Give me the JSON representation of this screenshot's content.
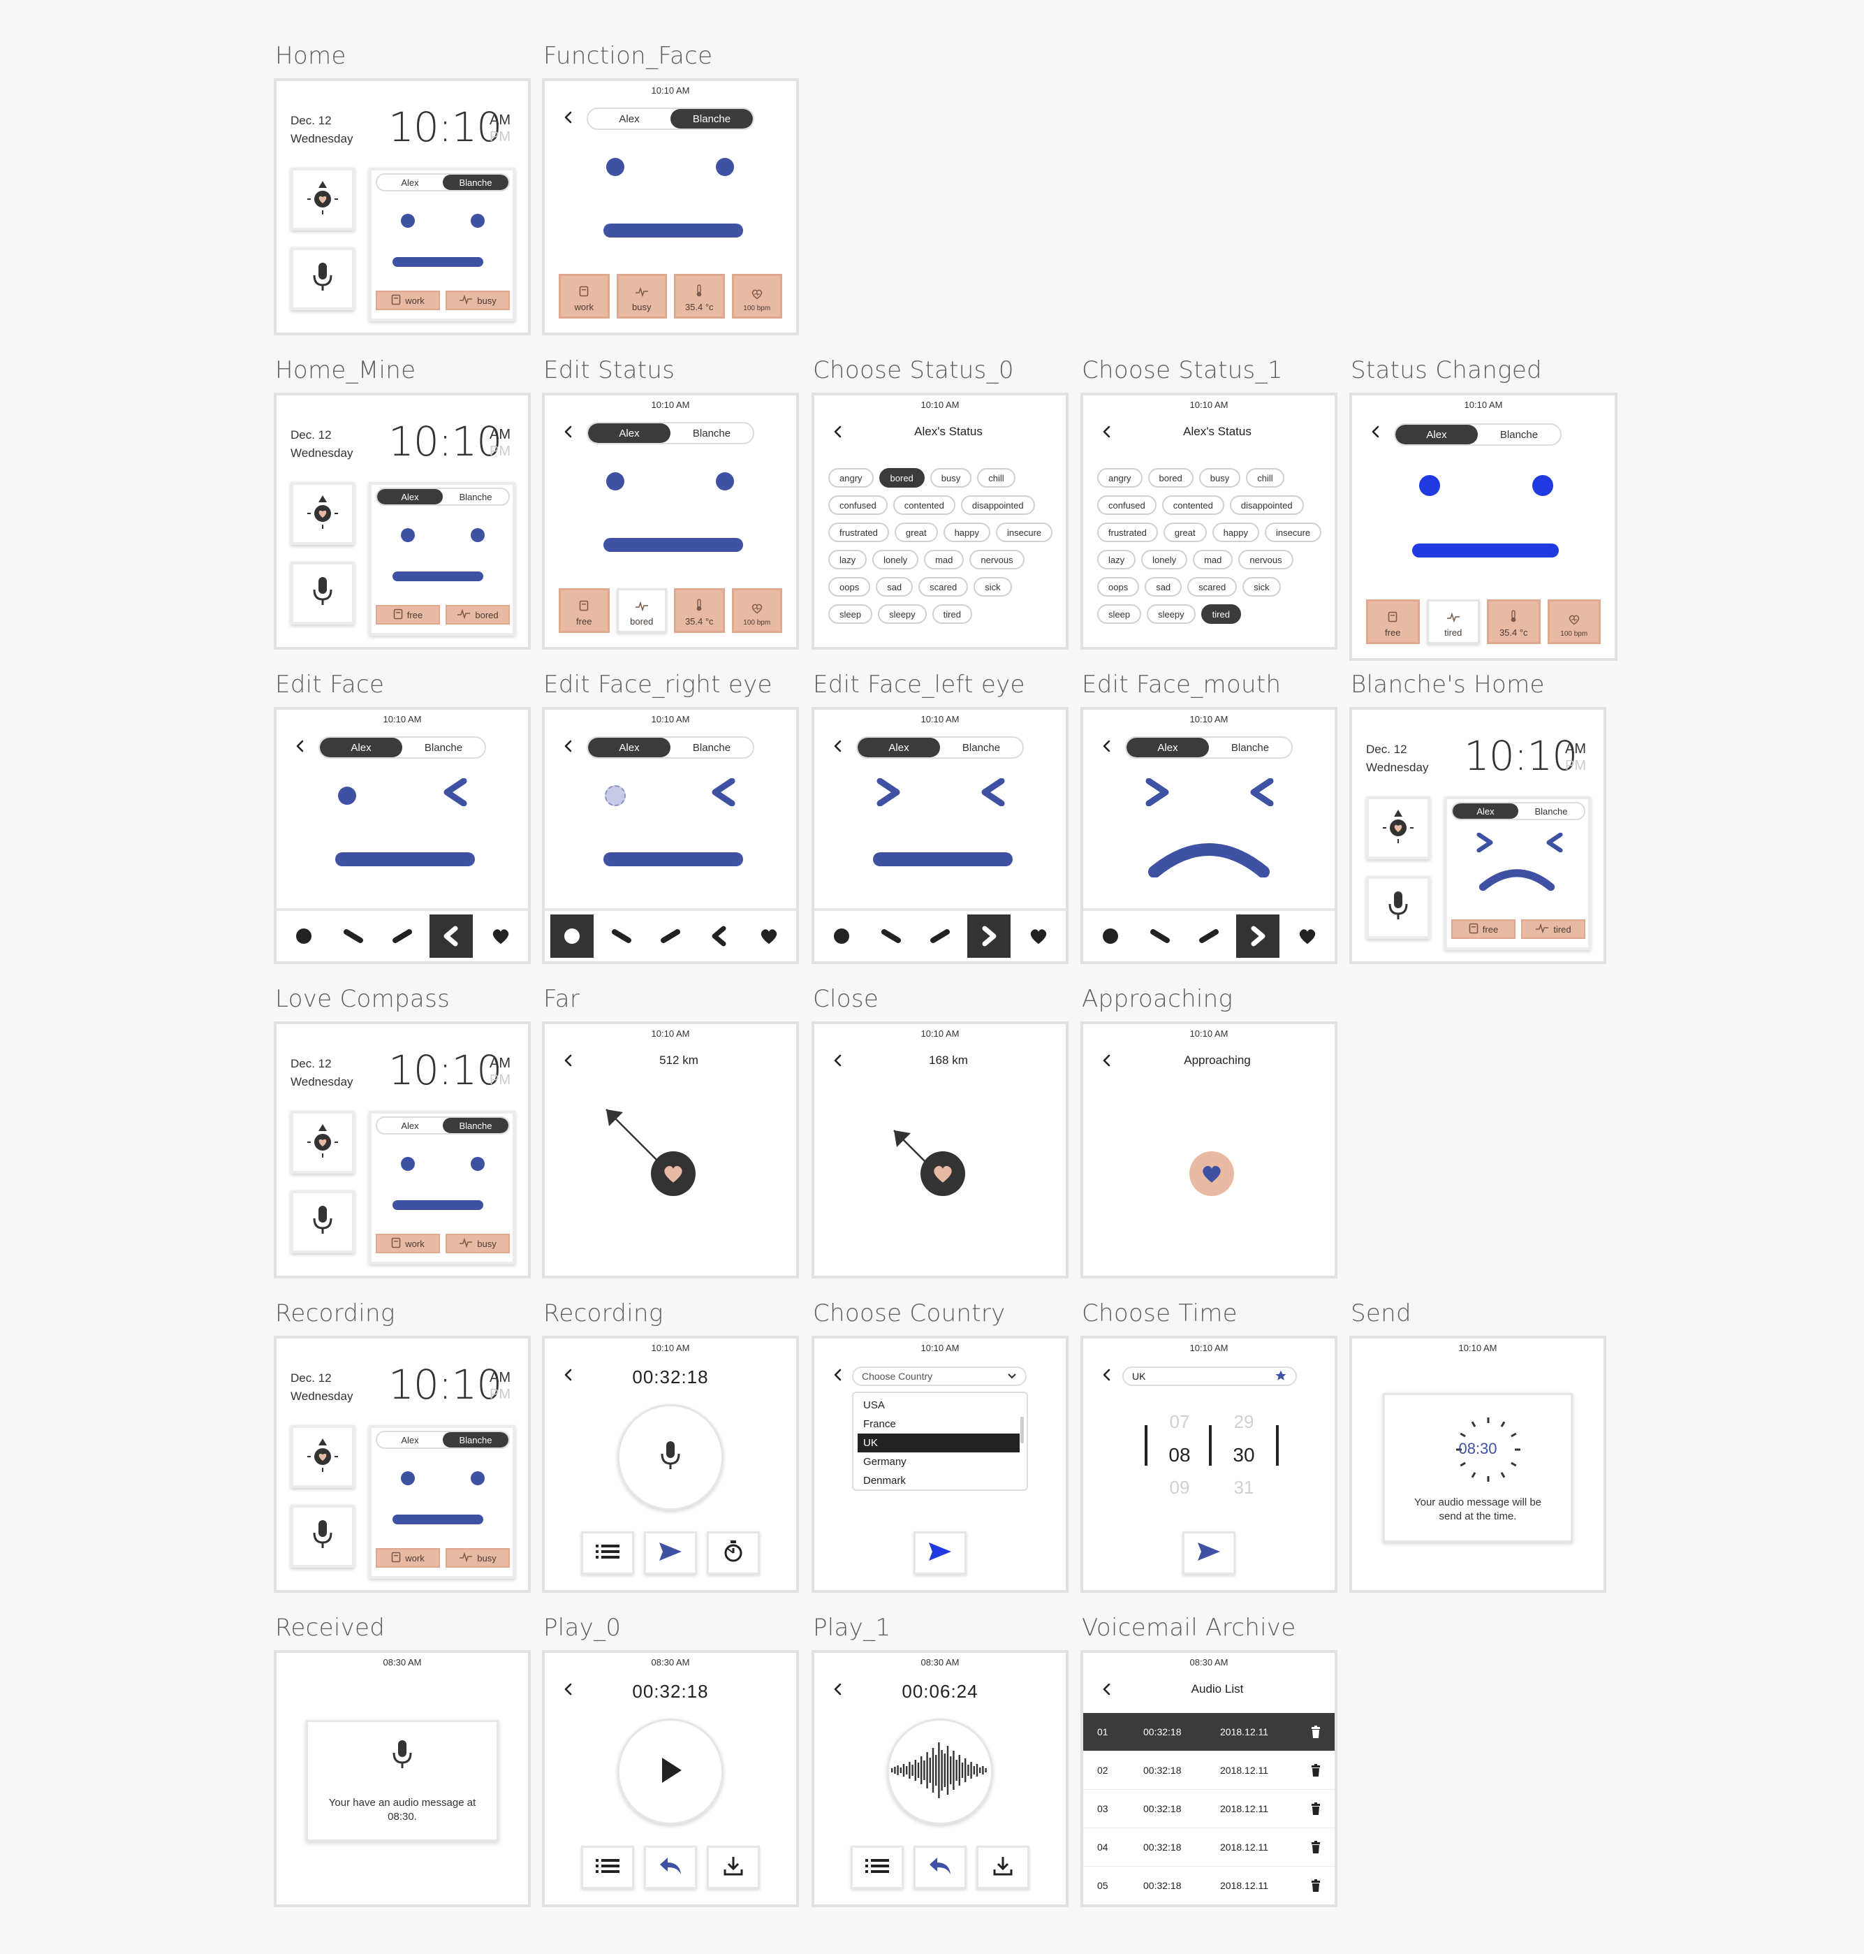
{
  "home": {
    "date": "Dec. 12",
    "weekday": "Wednesday",
    "time": "10:10",
    "am": "AM",
    "pm": "PM",
    "users": [
      "Alex",
      "Blanche"
    ]
  },
  "screens": {
    "home": {
      "title": "Home",
      "tags": [
        "work",
        "busy"
      ]
    },
    "function_face": {
      "title": "Function_Face",
      "status_time": "10:10 AM",
      "tiles": [
        "work",
        "busy",
        "35.4 °c",
        "100 bpm"
      ]
    },
    "home_mine": {
      "title": "Home_Mine",
      "tags": [
        "free",
        "bored"
      ]
    },
    "edit_status": {
      "title": "Edit Status",
      "status_time": "10:10 AM",
      "tiles": [
        "free",
        "bored",
        "35.4 °c",
        "100 bpm"
      ]
    },
    "choose_status_0": {
      "title": "Choose Status_0",
      "status_time": "10:10 AM",
      "header": "Alex's Status",
      "selected": "bored"
    },
    "choose_status_1": {
      "title": "Choose Status_1",
      "status_time": "10:10 AM",
      "header": "Alex's Status",
      "selected": "tired"
    },
    "status_changed": {
      "title": "Status Changed",
      "status_time": "10:10 AM",
      "tiles": [
        "free",
        "tired",
        "35.4 °c",
        "100 bpm"
      ]
    },
    "edit_face": {
      "title": "Edit Face",
      "status_time": "10:10 AM"
    },
    "edit_face_right_eye": {
      "title": "Edit Face_right eye",
      "status_time": "10:10 AM"
    },
    "edit_face_left_eye": {
      "title": "Edit Face_left eye",
      "status_time": "10:10 AM"
    },
    "edit_face_mouth": {
      "title": "Edit Face_mouth",
      "status_time": "10:10 AM"
    },
    "blanches_home": {
      "title": "Blanche's Home",
      "tags": [
        "free",
        "tired"
      ]
    },
    "love_compass": {
      "title": "Love Compass",
      "tags": [
        "work",
        "busy"
      ]
    },
    "far": {
      "title": "Far",
      "status_time": "10:10 AM",
      "header": "512 km"
    },
    "close": {
      "title": "Close",
      "status_time": "10:10 AM",
      "header": "168 km"
    },
    "approaching": {
      "title": "Approaching",
      "status_time": "10:10 AM",
      "header": "Approaching"
    },
    "recording_home": {
      "title": "Recording",
      "tags": [
        "work",
        "busy"
      ]
    },
    "recording": {
      "title": "Recording",
      "status_time": "10:10 AM",
      "timer": "00:32:18"
    },
    "choose_country": {
      "title": "Choose Country",
      "status_time": "10:10 AM",
      "placeholder": "Choose Country",
      "options": [
        "USA",
        "France",
        "UK",
        "Germany",
        "Denmark"
      ],
      "selected": "UK"
    },
    "choose_time": {
      "title": "Choose Time",
      "status_time": "10:10 AM",
      "country": "UK",
      "hours": [
        "07",
        "08",
        "09"
      ],
      "minutes": [
        "29",
        "30",
        "31"
      ]
    },
    "send": {
      "title": "Send",
      "status_time": "10:10 AM",
      "time": "08:30",
      "message": "Your audio message will be send at the time."
    },
    "received": {
      "title": "Received",
      "status_time": "08:30 AM",
      "message": "Your have an audio message at 08:30."
    },
    "play_0": {
      "title": "Play_0",
      "status_time": "08:30 AM",
      "timer": "00:32:18"
    },
    "play_1": {
      "title": "Play_1",
      "status_time": "08:30 AM",
      "timer": "00:06:24"
    },
    "voicemail_archive": {
      "title": "Voicemail Archive",
      "status_time": "08:30 AM",
      "header": "Audio List",
      "rows": [
        {
          "no": "01",
          "dur": "00:32:18",
          "date": "2018.12.11"
        },
        {
          "no": "02",
          "dur": "00:32:18",
          "date": "2018.12.11"
        },
        {
          "no": "03",
          "dur": "00:32:18",
          "date": "2018.12.11"
        },
        {
          "no": "04",
          "dur": "00:32:18",
          "date": "2018.12.11"
        },
        {
          "no": "05",
          "dur": "00:32:18",
          "date": "2018.12.11"
        }
      ]
    }
  },
  "status_words": [
    "angry",
    "bored",
    "busy",
    "chill",
    "confused",
    "contented",
    "disappointed",
    "frustrated",
    "great",
    "happy",
    "insecure",
    "lazy",
    "lonely",
    "mad",
    "nervous",
    "oops",
    "sad",
    "scared",
    "sick",
    "sleep",
    "sleepy",
    "tired"
  ],
  "icons": [
    "back-icon",
    "compass-icon",
    "heart-icon",
    "mic-icon",
    "list-icon",
    "send-icon",
    "timer-icon",
    "play-icon",
    "reply-icon",
    "download-icon",
    "trash-icon",
    "star-icon",
    "chevron-down-icon",
    "work-icon",
    "pulse-icon",
    "thermometer-icon"
  ],
  "colors": {
    "accent": "#3f51a3",
    "bright_blue": "#1f3ae0",
    "peach": "#e8b9a3",
    "dark": "#3b3b3b"
  }
}
